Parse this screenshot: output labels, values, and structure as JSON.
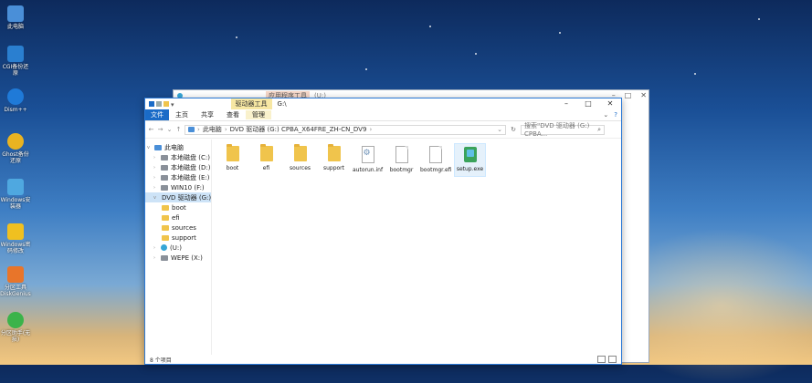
{
  "desktop": {
    "icons": [
      {
        "label": "此电脑"
      },
      {
        "label": "CGI备份还原"
      },
      {
        "label": "Dism++"
      },
      {
        "label": "Ghost备份还原"
      },
      {
        "label": "Windows安装器"
      },
      {
        "label": "Windows密码修改"
      },
      {
        "label": "分区工具DiskGenius"
      },
      {
        "label": "分区助手(无损)"
      }
    ]
  },
  "bg_window": {
    "highlight_tab": "应用程序工具",
    "title": "(U:)"
  },
  "window": {
    "tool_tab": "驱动器工具",
    "title": "G:\\",
    "ribbon": {
      "file": "文件",
      "tabs": [
        "主页",
        "共享",
        "查看",
        "管理"
      ]
    },
    "path": [
      "此电脑",
      "DVD 驱动器 (G:) CPBA_X64FRE_ZH-CN_DV9"
    ],
    "search_placeholder": "搜索\"DVD 驱动器 (G:) CPBA...",
    "nav": [
      {
        "label": "此电脑",
        "icon": "pc-icon",
        "level": 0
      },
      {
        "label": "本地磁盘 (C:)",
        "icon": "drive-icon",
        "level": 1
      },
      {
        "label": "本地磁盘 (D:)",
        "icon": "drive-icon",
        "level": 1
      },
      {
        "label": "本地磁盘 (E:)",
        "icon": "drive-icon",
        "level": 1
      },
      {
        "label": "WIN10 (F:)",
        "icon": "drive-icon",
        "level": 1
      },
      {
        "label": "DVD 驱动器 (G:) C",
        "icon": "dvd-icon",
        "level": 1,
        "selected": true
      },
      {
        "label": "boot",
        "icon": "folder-icon",
        "level": 2
      },
      {
        "label": "efi",
        "icon": "folder-icon",
        "level": 2
      },
      {
        "label": "sources",
        "icon": "folder-icon",
        "level": 2
      },
      {
        "label": "support",
        "icon": "folder-icon",
        "level": 2
      },
      {
        "label": "(U:)",
        "icon": "usb-icon",
        "level": 1
      },
      {
        "label": "WEPE (X:)",
        "icon": "drive-icon",
        "level": 1
      }
    ],
    "files": [
      {
        "name": "boot",
        "type": "folder"
      },
      {
        "name": "efi",
        "type": "folder"
      },
      {
        "name": "sources",
        "type": "folder"
      },
      {
        "name": "support",
        "type": "folder"
      },
      {
        "name": "autorun.inf",
        "type": "gear"
      },
      {
        "name": "bootmgr",
        "type": "doc"
      },
      {
        "name": "bootmgr.efi",
        "type": "doc"
      },
      {
        "name": "setup.exe",
        "type": "exe",
        "selected": true
      }
    ],
    "status": "8 个项目"
  }
}
